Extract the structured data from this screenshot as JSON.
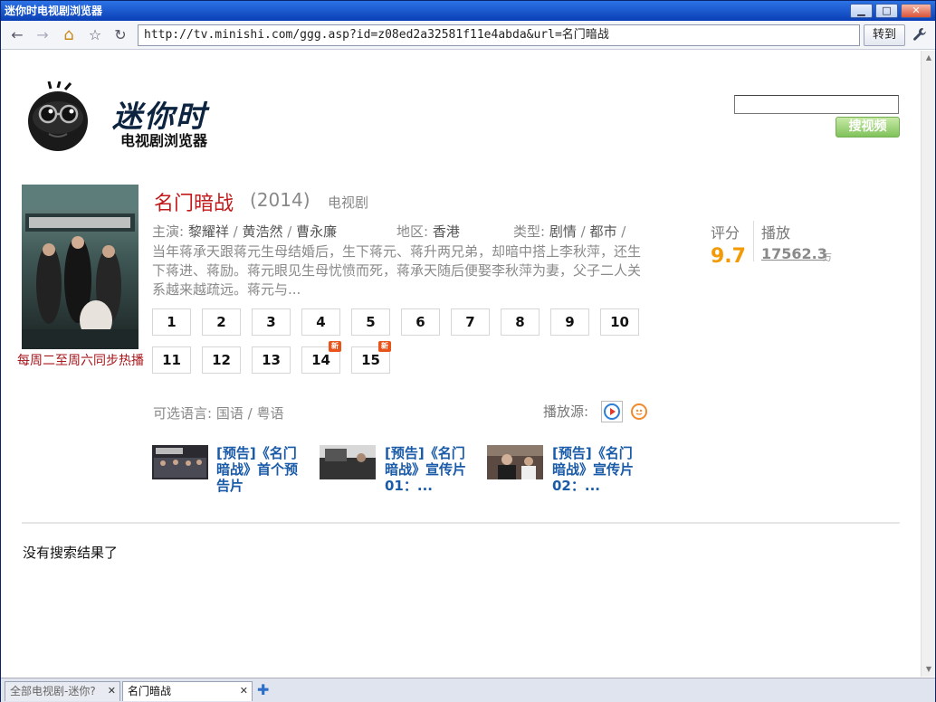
{
  "window": {
    "title": "迷你时电视剧浏览器",
    "minimize": "▁",
    "maximize": "□",
    "close": "✕"
  },
  "toolbar": {
    "back_icon": "←",
    "forward_icon": "→",
    "home_icon": "⌂",
    "star_icon": "☆",
    "reload_icon": "↻",
    "url": "http://tv.minishi.com/ggg.asp?id=z08ed2a32581f11e4abda&url=名门暗战",
    "go_label": "转到",
    "wrench_icon": "🔧"
  },
  "header": {
    "logo_title": "迷你时",
    "logo_subtitle": "电视剧浏览器",
    "search_placeholder": "",
    "search_button": "搜视频"
  },
  "show": {
    "poster_caption": "每周二至周六同步热播",
    "title": "名门暗战",
    "year": "(2014)",
    "genre": "电视剧",
    "cast_label": "主演:",
    "cast": [
      "黎耀祥",
      "黄浩然",
      "曹永廉"
    ],
    "region_label": "地区:",
    "region": "香港",
    "type_label": "类型:",
    "types": [
      "剧情",
      "都市"
    ],
    "synopsis": "当年蒋承天跟蒋元生母结婚后，生下蒋元、蒋升两兄弟，却暗中搭上李秋萍，还生下蒋进、蒋励。蒋元眼见生母忧愤而死，蒋承天随后便娶李秋萍为妻，父子二人关系越来越疏远。蒋元与...",
    "score_label": "评分",
    "score": "9.7",
    "play_label": "播放",
    "play_count": "17562.3",
    "play_unit": "万"
  },
  "episodes": [
    {
      "label": "1",
      "is_new": false
    },
    {
      "label": "2",
      "is_new": false
    },
    {
      "label": "3",
      "is_new": false
    },
    {
      "label": "4",
      "is_new": false
    },
    {
      "label": "5",
      "is_new": false
    },
    {
      "label": "6",
      "is_new": false
    },
    {
      "label": "7",
      "is_new": false
    },
    {
      "label": "8",
      "is_new": false
    },
    {
      "label": "9",
      "is_new": false
    },
    {
      "label": "10",
      "is_new": false
    },
    {
      "label": "11",
      "is_new": false
    },
    {
      "label": "12",
      "is_new": false
    },
    {
      "label": "13",
      "is_new": false
    },
    {
      "label": "14",
      "is_new": true
    },
    {
      "label": "15",
      "is_new": true
    }
  ],
  "new_badge": "新",
  "languages": {
    "label": "可选语言:",
    "options": [
      "国语",
      "粤语"
    ]
  },
  "source": {
    "label": "播放源:"
  },
  "clips": [
    {
      "title": "[预告]《名门暗战》首个预告片"
    },
    {
      "title": "[预告]《名门暗战》宣传片01：..."
    },
    {
      "title": "[预告]《名门暗战》宣传片02：..."
    }
  ],
  "results": {
    "empty_text": "没有搜索结果了"
  },
  "tabs": [
    {
      "label": "全部电视剧-迷你?",
      "active": false
    },
    {
      "label": "名门暗战",
      "active": true
    }
  ],
  "colors": {
    "title_red": "#c21a1a",
    "score_orange": "#f29b06",
    "link_blue": "#1a5ba8",
    "search_green": "#7fc25a"
  }
}
